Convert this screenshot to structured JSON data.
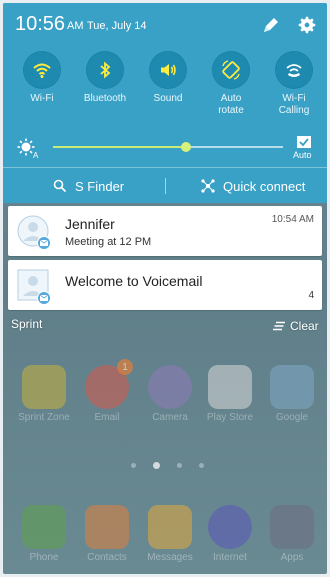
{
  "status": {
    "time": "10:56",
    "ampm": "AM",
    "date": "Tue, July 14"
  },
  "toggles": [
    {
      "label": "Wi-Fi",
      "icon": "wifi-icon"
    },
    {
      "label": "Bluetooth",
      "icon": "bluetooth-icon"
    },
    {
      "label": "Sound",
      "icon": "sound-icon"
    },
    {
      "label": "Auto\nrotate",
      "icon": "auto-rotate-icon"
    },
    {
      "label": "Wi-Fi\nCalling",
      "icon": "wifi-calling-icon"
    }
  ],
  "brightness": {
    "level": 0.58,
    "auto_label": "Auto",
    "auto_checked": true
  },
  "finder": {
    "sfinder_label": "S Finder",
    "quick_connect_label": "Quick connect"
  },
  "notifications": [
    {
      "title": "Jennifer",
      "subtitle": "Meeting at 12 PM",
      "time": "10:54 AM"
    },
    {
      "title": "Welcome to Voicemail",
      "count": "4"
    }
  ],
  "carrier": "Sprint",
  "clear_label": "Clear",
  "home_apps": [
    {
      "label": "Sprint Zone",
      "icon": "sprint-zone-icon"
    },
    {
      "label": "Email",
      "icon": "email-icon",
      "badge": "1"
    },
    {
      "label": "Camera",
      "icon": "camera-icon"
    },
    {
      "label": "Play Store",
      "icon": "play-store-icon"
    },
    {
      "label": "Google",
      "icon": "google-folder-icon"
    }
  ],
  "dock_apps": [
    {
      "label": "Phone",
      "icon": "phone-icon"
    },
    {
      "label": "Contacts",
      "icon": "contacts-icon"
    },
    {
      "label": "Messages",
      "icon": "messages-icon"
    },
    {
      "label": "Internet",
      "icon": "internet-icon"
    },
    {
      "label": "Apps",
      "icon": "apps-icon"
    }
  ],
  "colors": {
    "panel": "#3aa1c6",
    "toggle_active": "#1f8ab0",
    "slider": "#c9ea77",
    "badge": "#56a9da"
  }
}
